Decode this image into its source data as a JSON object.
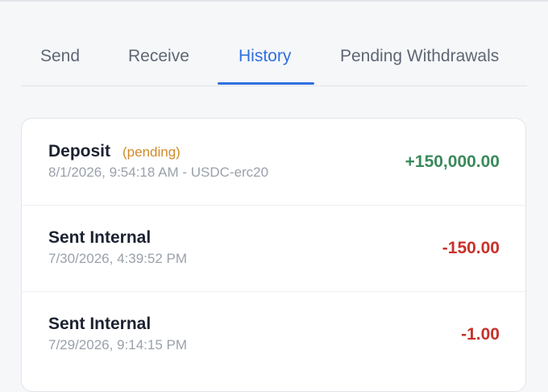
{
  "colors": {
    "accent": "#2f6fe0",
    "positive": "#3a8a5c",
    "negative": "#c8322b",
    "pending": "#d08a2a"
  },
  "tabs": [
    {
      "label": "Send",
      "active": false
    },
    {
      "label": "Receive",
      "active": false
    },
    {
      "label": "History",
      "active": true
    },
    {
      "label": "Pending Withdrawals",
      "active": false
    }
  ],
  "history": {
    "rows": [
      {
        "title": "Deposit",
        "status": "(pending)",
        "subtitle": "8/1/2026, 9:54:18 AM - USDC-erc20",
        "amount": "+150,000.00"
      },
      {
        "title": "Sent Internal",
        "status": "",
        "subtitle": "7/30/2026, 4:39:52 PM",
        "amount": "-150.00"
      },
      {
        "title": "Sent Internal",
        "status": "",
        "subtitle": "7/29/2026, 9:14:15 PM",
        "amount": "-1.00"
      }
    ]
  }
}
